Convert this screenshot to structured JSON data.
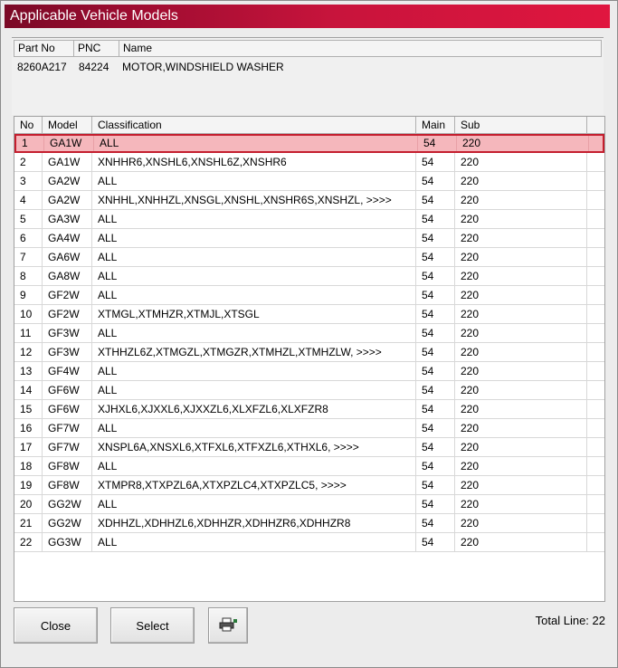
{
  "window": {
    "title": "Applicable Vehicle Models"
  },
  "part": {
    "headers": {
      "part_no": "Part No",
      "pnc": "PNC",
      "name": "Name"
    },
    "part_no": "8260A217",
    "pnc": "84224",
    "name": "MOTOR,WINDSHIELD WASHER"
  },
  "grid": {
    "headers": {
      "no": "No",
      "model": "Model",
      "classification": "Classification",
      "main": "Main",
      "sub": "Sub"
    },
    "selected_row": 0,
    "rows": [
      {
        "no": "1",
        "model": "GA1W",
        "classification": "ALL",
        "main": "54",
        "sub": "220"
      },
      {
        "no": "2",
        "model": "GA1W",
        "classification": "XNHHR6,XNSHL6,XNSHL6Z,XNSHR6",
        "main": "54",
        "sub": "220"
      },
      {
        "no": "3",
        "model": "GA2W",
        "classification": "ALL",
        "main": "54",
        "sub": "220"
      },
      {
        "no": "4",
        "model": "GA2W",
        "classification": "XNHHL,XNHHZL,XNSGL,XNSHL,XNSHR6S,XNSHZL,  >>>>",
        "main": "54",
        "sub": "220"
      },
      {
        "no": "5",
        "model": "GA3W",
        "classification": "ALL",
        "main": "54",
        "sub": "220"
      },
      {
        "no": "6",
        "model": "GA4W",
        "classification": "ALL",
        "main": "54",
        "sub": "220"
      },
      {
        "no": "7",
        "model": "GA6W",
        "classification": "ALL",
        "main": "54",
        "sub": "220"
      },
      {
        "no": "8",
        "model": "GA8W",
        "classification": "ALL",
        "main": "54",
        "sub": "220"
      },
      {
        "no": "9",
        "model": "GF2W",
        "classification": "ALL",
        "main": "54",
        "sub": "220"
      },
      {
        "no": "10",
        "model": "GF2W",
        "classification": "XTMGL,XTMHZR,XTMJL,XTSGL",
        "main": "54",
        "sub": "220"
      },
      {
        "no": "11",
        "model": "GF3W",
        "classification": "ALL",
        "main": "54",
        "sub": "220"
      },
      {
        "no": "12",
        "model": "GF3W",
        "classification": "XTHHZL6Z,XTMGZL,XTMGZR,XTMHZL,XTMHZLW,  >>>>",
        "main": "54",
        "sub": "220"
      },
      {
        "no": "13",
        "model": "GF4W",
        "classification": "ALL",
        "main": "54",
        "sub": "220"
      },
      {
        "no": "14",
        "model": "GF6W",
        "classification": "ALL",
        "main": "54",
        "sub": "220"
      },
      {
        "no": "15",
        "model": "GF6W",
        "classification": "XJHXL6,XJXXL6,XJXXZL6,XLXFZL6,XLXFZR8",
        "main": "54",
        "sub": "220"
      },
      {
        "no": "16",
        "model": "GF7W",
        "classification": "ALL",
        "main": "54",
        "sub": "220"
      },
      {
        "no": "17",
        "model": "GF7W",
        "classification": "XNSPL6A,XNSXL6,XTFXL6,XTFXZL6,XTHXL6,  >>>>",
        "main": "54",
        "sub": "220"
      },
      {
        "no": "18",
        "model": "GF8W",
        "classification": "ALL",
        "main": "54",
        "sub": "220"
      },
      {
        "no": "19",
        "model": "GF8W",
        "classification": "XTMPR8,XTXPZL6A,XTXPZLC4,XTXPZLC5,  >>>>",
        "main": "54",
        "sub": "220"
      },
      {
        "no": "20",
        "model": "GG2W",
        "classification": "ALL",
        "main": "54",
        "sub": "220"
      },
      {
        "no": "21",
        "model": "GG2W",
        "classification": "XDHHZL,XDHHZL6,XDHHZR,XDHHZR6,XDHHZR8",
        "main": "54",
        "sub": "220"
      },
      {
        "no": "22",
        "model": "GG3W",
        "classification": "ALL",
        "main": "54",
        "sub": "220"
      }
    ]
  },
  "buttons": {
    "close": "Close",
    "select": "Select",
    "print_icon": "printer-icon"
  },
  "footer": {
    "total_line": "Total Line: 22"
  },
  "colors": {
    "title_bar": "#c8143c",
    "selected_row_bg": "#f5b7bc",
    "selected_row_border": "#c41e2e"
  }
}
